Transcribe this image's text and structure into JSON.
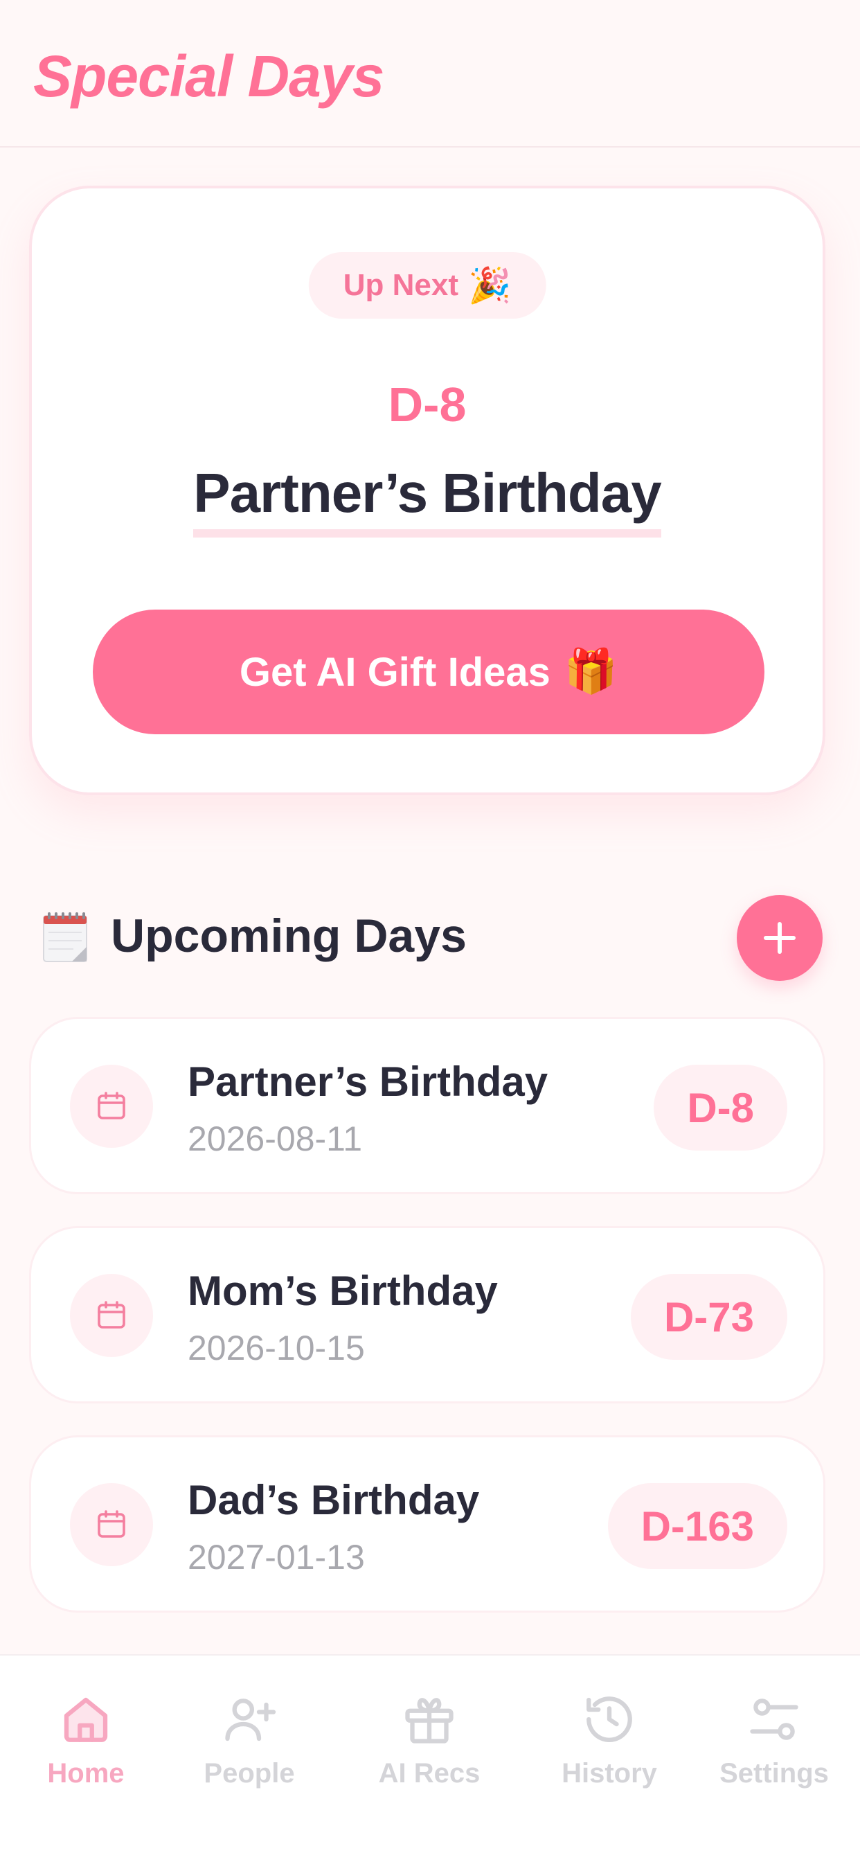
{
  "header": {
    "title": "Special Days"
  },
  "hero": {
    "badge_label": "Up Next",
    "badge_emoji": "🎉",
    "dday": "D-8",
    "name": "Partner’s Birthday",
    "cta_label": "Get AI Gift Ideas",
    "cta_emoji": "🎁"
  },
  "section": {
    "icon": "calendar-icon",
    "title": "Upcoming Days",
    "add_icon": "plus-icon"
  },
  "events": [
    {
      "name": "Partner’s Birthday",
      "date": "2026-08-11",
      "dday": "D-8",
      "icon": "calendar-icon"
    },
    {
      "name": "Mom’s Birthday",
      "date": "2026-10-15",
      "dday": "D-73",
      "icon": "calendar-icon"
    },
    {
      "name": "Dad’s Birthday",
      "date": "2027-01-13",
      "dday": "D-163",
      "icon": "calendar-icon"
    }
  ],
  "tabs": [
    {
      "label": "Home",
      "icon": "home-icon",
      "active": true
    },
    {
      "label": "People",
      "icon": "add-person-icon",
      "active": false
    },
    {
      "label": "AI Recs",
      "icon": "gift-icon",
      "active": false
    },
    {
      "label": "History",
      "icon": "history-icon",
      "active": false
    },
    {
      "label": "Settings",
      "icon": "sliders-icon",
      "active": false
    }
  ],
  "colors": {
    "accent": "#ff7196",
    "accent_soft": "#fff0f3",
    "text_dark": "#2a2a3a",
    "text_muted": "#a8a8ae",
    "tab_inactive": "#d4d4d8",
    "tab_active": "#f7a7c0"
  }
}
